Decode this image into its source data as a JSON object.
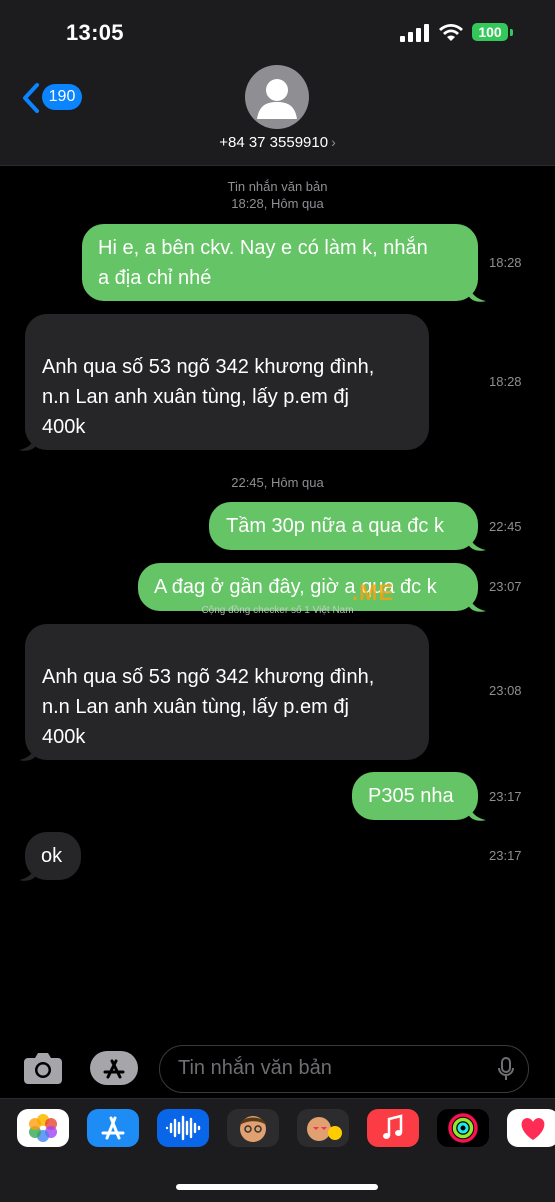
{
  "status_bar": {
    "time": "13:05",
    "battery": "100"
  },
  "header": {
    "back_count": "190",
    "contact": "+84 37 3559910",
    "contact_chevron": "›"
  },
  "meta": {
    "service_label": "Tin nhắn văn bản",
    "service_time": "18:28, Hôm qua",
    "second_time": "22:45, Hôm qua"
  },
  "messages": [
    {
      "direction": "out",
      "lines": [
        "Hi e, a bên ckv. Nay e có làm k, nhắn",
        "a địa chỉ nhé"
      ],
      "time": "18:28"
    },
    {
      "direction": "in",
      "lines": [
        "Anh qua số 53 ngõ 342 khương đình,",
        "n.n Lan anh xuân tùng, lấy p.em đj",
        "400k"
      ],
      "time": "18:28"
    },
    {
      "direction": "out",
      "lines": [
        "Tầm 30p nữa a qua đc k"
      ],
      "time": "22:45"
    },
    {
      "direction": "out",
      "lines": [
        "A đag ở gần đây, giờ a qua đc k"
      ],
      "time": "23:07"
    },
    {
      "direction": "in",
      "lines": [
        "Anh qua số 53 ngõ 342 khương đình,",
        "n.n Lan anh xuân tùng, lấy p.em đj",
        "400k"
      ],
      "time": "23:08"
    },
    {
      "direction": "out",
      "lines": [
        "P305 nha"
      ],
      "time": "23:17"
    },
    {
      "direction": "in",
      "lines": [
        "ok"
      ],
      "time": "23:17"
    }
  ],
  "watermark": {
    "logo": ".ME",
    "text": "Cộng đồng checker số 1 Việt Nam"
  },
  "input": {
    "placeholder": "Tin nhắn văn bản"
  },
  "tray_apps": [
    {
      "icon": "photos-icon"
    },
    {
      "icon": "app-store-icon"
    },
    {
      "icon": "audio-message-icon"
    },
    {
      "icon": "memoji-icon"
    },
    {
      "icon": "memoji-stickers-icon"
    },
    {
      "icon": "music-icon"
    },
    {
      "icon": "activity-icon"
    },
    {
      "icon": "digital-touch-icon"
    }
  ],
  "colors": {
    "outgoing": "#65c466",
    "incoming": "#262628",
    "accent": "#0a84ff"
  }
}
